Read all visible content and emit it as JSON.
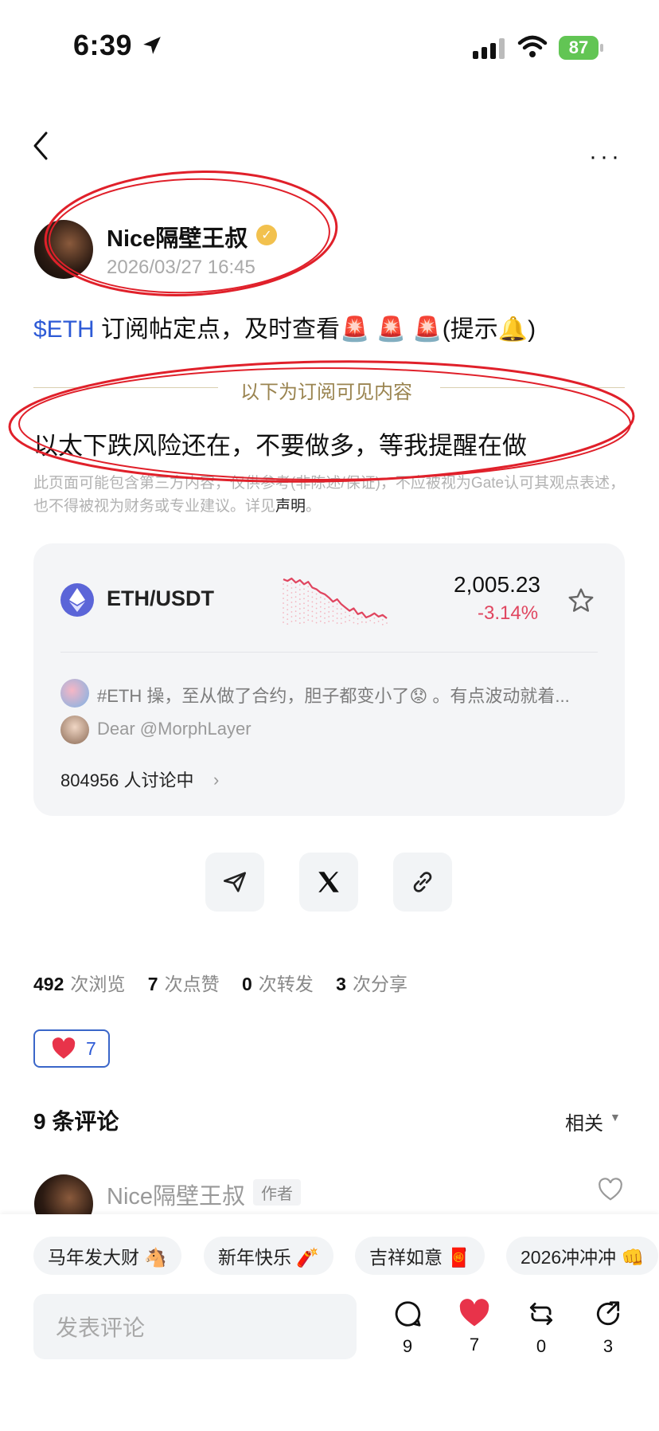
{
  "status_bar": {
    "time": "6:39",
    "battery": "87"
  },
  "nav": {
    "more": "···"
  },
  "author": {
    "name": "Nice隔壁王叔",
    "verified": "✓",
    "date": "2026/03/27 16:45"
  },
  "post": {
    "tag": "$ETH",
    "text": " 订阅帖定点，及时查看🚨 🚨 🚨(提示🔔)",
    "sub_label": "以下为订阅可见内容",
    "sub_content": "以太下跌风险还在，不要做多，等我提醒在做",
    "disclaimer": "此页面可能包含第三方内容，仅供参考(非陈述/保证)，不应被视为Gate认可其观点表述，也不得被视为财务或专业建议。详见",
    "disclaimer_link": "声明",
    "disclaimer_end": "。"
  },
  "market": {
    "pair": "ETH/USDT",
    "price": "2,005.23",
    "change": "-3.14%",
    "comment1": "#ETH 操，至从做了合约，胆子都变小了😟 。有点波动就着...",
    "comment2": "Dear @MorphLayer",
    "discussing": "804956 人讨论中",
    "sparkline": [
      82,
      80,
      83,
      78,
      81,
      76,
      79,
      72,
      70,
      66,
      64,
      60,
      55,
      58,
      52,
      48,
      44,
      47,
      40,
      42,
      36,
      38,
      41,
      37,
      39,
      35
    ]
  },
  "stats": {
    "views": "492",
    "views_label": "次浏览",
    "likes": "7",
    "likes_label": "次点赞",
    "reposts": "0",
    "reposts_label": "次转发",
    "shares": "3",
    "shares_label": "次分享"
  },
  "like_chip": {
    "count": "7"
  },
  "comments": {
    "title": "9 条评论",
    "sort": "相关",
    "first_name": "Nice隔壁王叔",
    "author_badge": "作者"
  },
  "chips": [
    "马年发大财 🐴",
    "新年快乐 🧨",
    "吉祥如意 🧧",
    "2026冲冲冲 👊"
  ],
  "composer": {
    "placeholder": "发表评论"
  },
  "actions": {
    "comments": "9",
    "likes": "7",
    "reposts": "0",
    "shares": "3"
  },
  "colors": {
    "accent": "#2d5ad6",
    "down": "#e0455f",
    "annotation": "#e0202a"
  }
}
